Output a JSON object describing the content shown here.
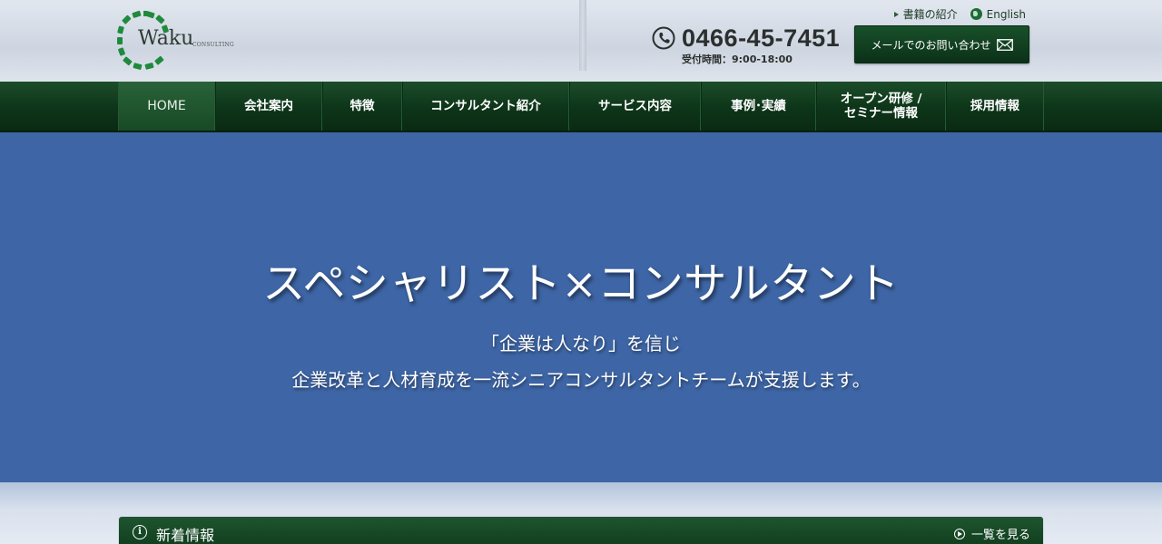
{
  "brand": {
    "logo_text": "Waku",
    "logo_sub": "CONSULTING"
  },
  "top_links": {
    "books": "書籍の紹介",
    "english": "English"
  },
  "contact": {
    "phone": "0466-45-7451",
    "hours": "受付時間：9:00-18:00",
    "mail_button": "メールでのお問い合わせ"
  },
  "nav": {
    "items": [
      {
        "label": "HOME"
      },
      {
        "label": "会社案内"
      },
      {
        "label": "特徴"
      },
      {
        "label": "コンサルタント紹介"
      },
      {
        "label": "サービス内容"
      },
      {
        "label": "事例･実績"
      },
      {
        "label_line1": "オープン研修 /",
        "label_line2": "セミナー情報"
      },
      {
        "label": "採用情報"
      }
    ]
  },
  "hero": {
    "title": "スペシャリスト×コンサルタント",
    "sub1": "「企業は人なり」を信じ",
    "sub2": "企業改革と人材育成を一流シニアコンサルタントチームが支援します。"
  },
  "news": {
    "title": "新着情報",
    "more": "一覧を見る"
  },
  "colors": {
    "nav_green": "#0d3519",
    "hero_blue": "#3e66a6",
    "logo_green": "#1f8a3c"
  }
}
